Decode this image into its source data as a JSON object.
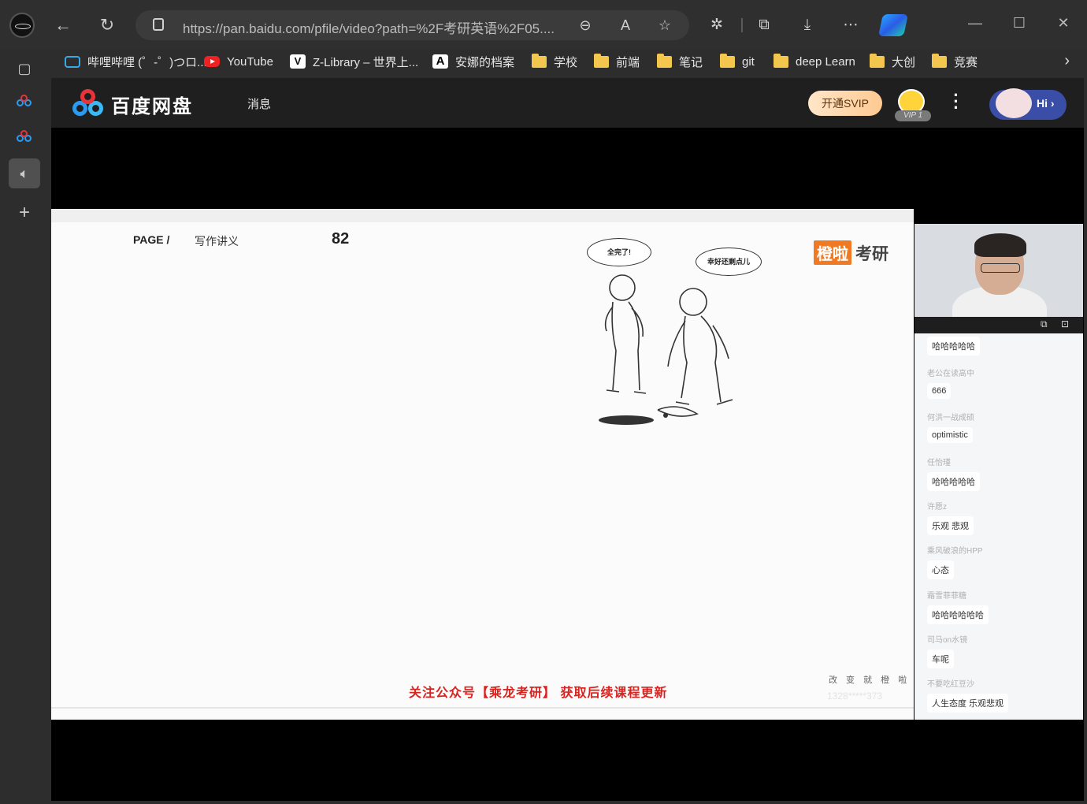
{
  "browser": {
    "url": "https://pan.baidu.com/pfile/video?path=%2F考研英语%2F05....",
    "minimize": "—",
    "maximize": "☐",
    "close": "✕"
  },
  "bookmarks": [
    {
      "label": "哔哩哔哩 (゜-゜)つロ...",
      "type": "bilibili"
    },
    {
      "label": "YouTube",
      "type": "youtube"
    },
    {
      "label": "Z-Library – 世界上...",
      "type": "zlib"
    },
    {
      "label": "安娜的档案",
      "type": "anna"
    },
    {
      "label": "学校",
      "type": "folder"
    },
    {
      "label": "前端",
      "type": "folder"
    },
    {
      "label": "笔记",
      "type": "folder"
    },
    {
      "label": "git",
      "type": "folder"
    },
    {
      "label": "deep Learn",
      "type": "folder"
    },
    {
      "label": "大创",
      "type": "folder"
    },
    {
      "label": "竞赛",
      "type": "folder"
    }
  ],
  "baidu": {
    "title": "百度网盘",
    "messages": "消息",
    "svip": "开通SVIP",
    "vip_level": "VIP 1",
    "hi": "Hi ›"
  },
  "slide": {
    "page_label": "PAGE /",
    "section": "写作讲义",
    "page_number": "82",
    "brand_a": "橙啦",
    "brand_b": "考研",
    "bubble_left": "全完了!",
    "bubble_right": "幸好还剩点儿",
    "promo": "关注公众号【乘龙考研】 获取后续课程更新",
    "corner_note": "改 变 就 橙 啦",
    "corner_faint": "1328*****373"
  },
  "chat": [
    {
      "name": "",
      "text": "哈哈哈哈哈"
    },
    {
      "name": "老公在读高中",
      "text": "666"
    },
    {
      "name": "何洪一战成硕",
      "text": "optimistic"
    },
    {
      "name": "任怡瑾",
      "text": "哈哈哈哈哈"
    },
    {
      "name": "许愿z",
      "text": "乐观 悲观"
    },
    {
      "name": "乘风破浪的HPP",
      "text": "心态"
    },
    {
      "name": "霜雪菲菲糖",
      "text": "哈哈哈哈哈哈"
    },
    {
      "name": "司马on水镜",
      "text": "车呢"
    },
    {
      "name": "不要吃红豆沙",
      "text": "人生态度 乐观悲观"
    }
  ],
  "colors": {
    "promo": "#d8231f",
    "brand_orange": "#f07a23",
    "svip_gold": "#ffc992",
    "baidu_blue": "#2b9bf0"
  }
}
